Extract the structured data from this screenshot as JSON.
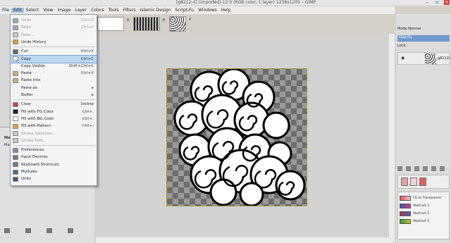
{
  "window": {
    "title": "[g8212-4] (imported)-12.0 (RGB color, 1 layer) 1238x1205 – GIMP"
  },
  "menubar": [
    "File",
    "Edit",
    "Select",
    "View",
    "Image",
    "Layer",
    "Colors",
    "Tools",
    "Filters",
    "Islamic-Design",
    "Script-Fu",
    "Windows",
    "Help"
  ],
  "edit_menu": [
    {
      "label": "Undo",
      "shortcut": "Ctrl+Z",
      "enabled": false,
      "icon": "undo-icon",
      "color": "#9aa8b8"
    },
    {
      "label": "Redo",
      "shortcut": "Ctrl+Y",
      "enabled": false,
      "icon": "redo-icon",
      "color": "#9aa8b8"
    },
    {
      "label": "Fade...",
      "shortcut": "",
      "enabled": false,
      "icon": "fade-icon",
      "color": "#c8c8c8"
    },
    {
      "label": "Undo History",
      "shortcut": "",
      "enabled": true,
      "icon": "undo-history-icon",
      "color": "#d8a030"
    },
    {
      "label": "Cut",
      "shortcut": "Ctrl+X",
      "enabled": true,
      "icon": "cut-icon",
      "color": "#5a6a8a"
    },
    {
      "label": "Copy",
      "shortcut": "Ctrl+C",
      "enabled": true,
      "highlighted": true,
      "icon": "copy-icon",
      "color": "#ffffff"
    },
    {
      "label": "Copy Visible",
      "shortcut": "Shift+Ctrl+C",
      "enabled": true,
      "icon": "",
      "color": ""
    },
    {
      "label": "Paste",
      "shortcut": "Ctrl+V",
      "enabled": true,
      "icon": "paste-icon",
      "color": "#c8b070"
    },
    {
      "label": "Paste Into",
      "shortcut": "",
      "enabled": true,
      "icon": "paste-into-icon",
      "color": "#c8b070"
    },
    {
      "label": "Paste as",
      "shortcut": "",
      "enabled": true,
      "submenu": true,
      "icon": "",
      "color": ""
    },
    {
      "label": "Buffer",
      "shortcut": "",
      "enabled": true,
      "submenu": true,
      "icon": "",
      "color": ""
    },
    {
      "label": "Clear",
      "shortcut": "Delete",
      "enabled": true,
      "icon": "clear-icon",
      "color": "#d04040"
    },
    {
      "label": "Fill with FG Color",
      "shortcut": "Ctrl+,",
      "enabled": true,
      "icon": "fill-fg-icon",
      "color": "#222222"
    },
    {
      "label": "Fill with BG Color",
      "shortcut": "Ctrl+.",
      "enabled": true,
      "icon": "fill-bg-icon",
      "color": "#ffffff"
    },
    {
      "label": "Fill with Pattern",
      "shortcut": "Ctrl+;",
      "enabled": true,
      "icon": "fill-pattern-icon",
      "color": "#e0a040"
    },
    {
      "label": "Stroke Selection...",
      "shortcut": "",
      "enabled": false,
      "icon": "stroke-selection-icon",
      "color": "#c8c8c8"
    },
    {
      "label": "Stroke Path...",
      "shortcut": "",
      "enabled": false,
      "icon": "stroke-path-icon",
      "color": "#c8c8c8"
    },
    {
      "label": "Preferences",
      "shortcut": "",
      "enabled": true,
      "icon": "preferences-icon",
      "color": "#7a8aa0"
    },
    {
      "label": "Input Devices",
      "shortcut": "",
      "enabled": true,
      "icon": "input-devices-icon",
      "color": "#6a7a90"
    },
    {
      "label": "Keyboard Shortcuts",
      "shortcut": "",
      "enabled": true,
      "icon": "keyboard-icon",
      "color": "#6a7a90"
    },
    {
      "label": "Modules",
      "shortcut": "",
      "enabled": true,
      "icon": "modules-icon",
      "color": "#4a6a90"
    },
    {
      "label": "Units",
      "shortcut": "",
      "enabled": true,
      "icon": "units-icon",
      "color": "#3a5a80"
    }
  ],
  "right_panel": {
    "mode_label": "Mode",
    "mode_value": "Normal",
    "opacity_label": "Opacity",
    "lock_label": "Lock:",
    "layer_name": "g8212-4",
    "gradients": [
      {
        "name": "FG to Transparent",
        "color_a": "#e05050",
        "color_b": "#f0d0d0"
      },
      {
        "name": "Abstract 1",
        "color_a": "#3050c0",
        "color_b": "#e04060"
      },
      {
        "name": "Abstract 2",
        "color_a": "#c03040",
        "color_b": "#4060d0"
      },
      {
        "name": "Abstract 3",
        "color_a": "#20a040",
        "color_b": "#d0c020"
      }
    ],
    "swatches": [
      "#e0a0a0",
      "#f0d0d0",
      "#e06060"
    ]
  },
  "left_panel": {
    "labels": [
      "Mo",
      "Ma"
    ]
  },
  "colors": {
    "menu_highlight": "#bcd7f2",
    "selection_border": "#bba200"
  }
}
